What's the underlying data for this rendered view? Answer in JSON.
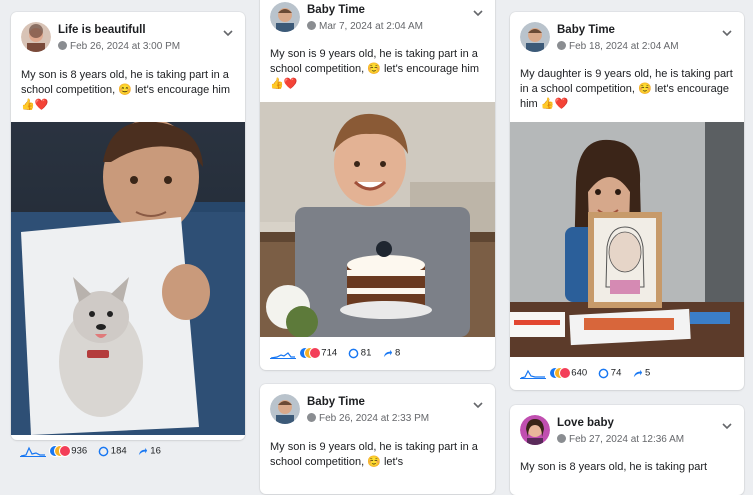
{
  "posts": [
    {
      "page_name": "Life is beautifull",
      "date": "Feb 26, 2024 at 3:00 PM",
      "text": "My son is 8 years old, he is taking part in a school competition, 😊 let's encourage him 👍❤️",
      "reactions": "936",
      "comments": "184",
      "shares": "16"
    },
    {
      "page_name": "Baby Time",
      "date": "Mar 7, 2024 at 2:04 AM",
      "text": "My son is 9 years old, he is taking part in a school competition, ☺️ let's encourage him 👍❤️",
      "reactions": "714",
      "comments": "81",
      "shares": "8"
    },
    {
      "page_name": "Baby Time",
      "date": "Feb 26, 2024 at 2:33 PM",
      "text": "My son is 9 years old, he is taking part in a school competition, ☺️ let's"
    },
    {
      "page_name": "Baby Time",
      "date": "Feb 18, 2024 at 2:04 AM",
      "text": "My daughter is 9 years old, he is taking part in a school competition, ☺️ let's encourage him 👍❤️",
      "reactions": "640",
      "comments": "74",
      "shares": "5"
    },
    {
      "page_name": "Love baby",
      "date": "Feb 27, 2024 at 12:36 AM",
      "text": "My son is 8 years old, he is taking part"
    }
  ],
  "colors": {
    "background": "#eceef1",
    "like_blue": "#1877f2",
    "love_red": "#f33e58",
    "care_yellow": "#f7b125",
    "sparkline": "#1877f2"
  },
  "icons": [
    "globe-icon",
    "chevron-down-icon",
    "sparkline-icon",
    "reaction-icons",
    "comment-icon",
    "share-icon"
  ]
}
